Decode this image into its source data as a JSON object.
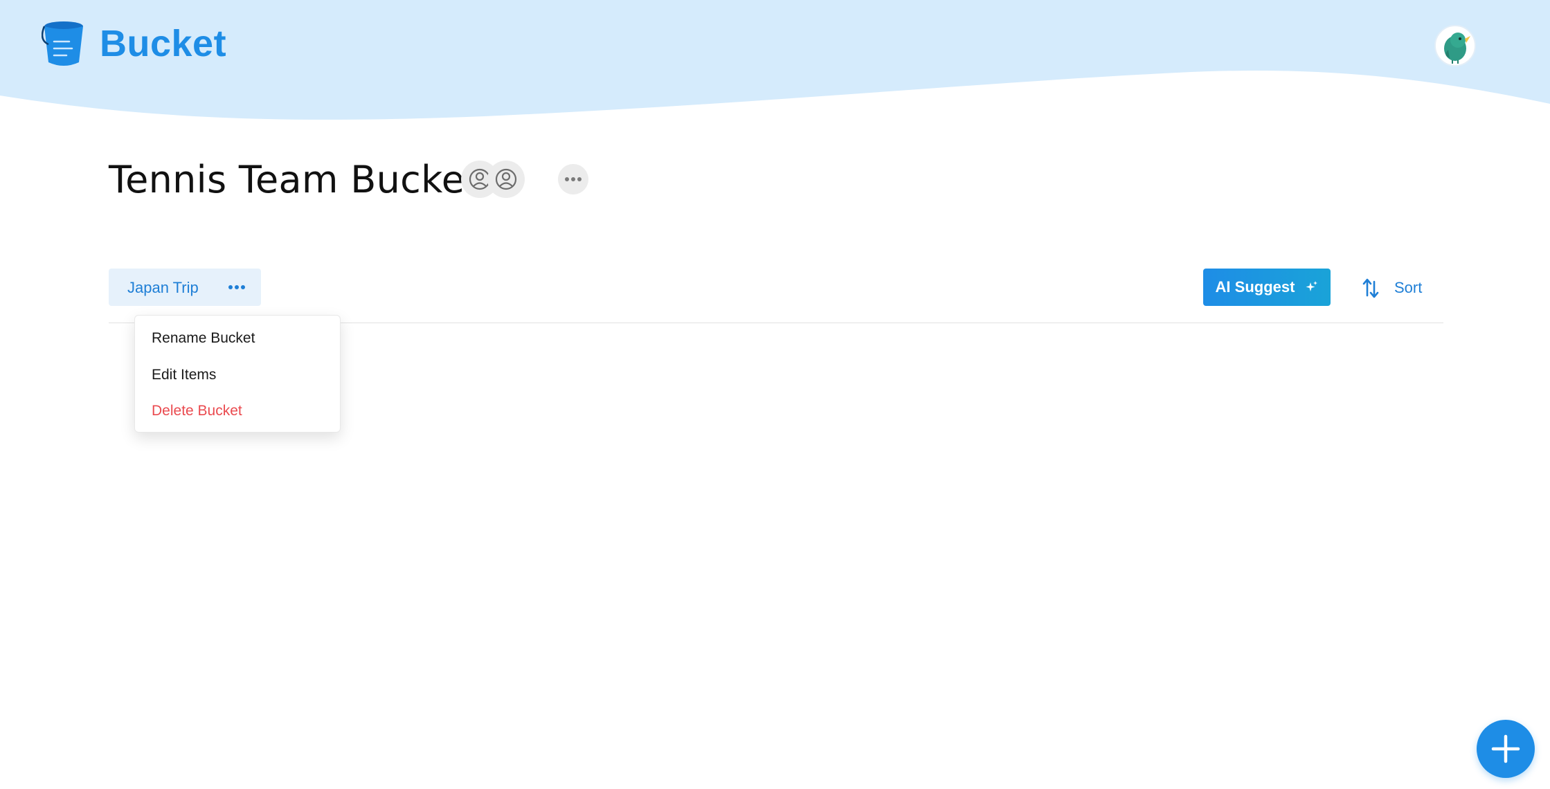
{
  "app": {
    "name": "Bucket",
    "brand_color": "#1e8de6",
    "header_color": "#d5ebfc"
  },
  "header": {
    "logo_icon": "bucket-icon",
    "user_avatar_icon": "bird-avatar-icon"
  },
  "page": {
    "title": "Tennis Team Buckets",
    "members": [
      {
        "icon": "user-circle-icon"
      },
      {
        "icon": "user-circle-icon"
      }
    ],
    "more_icon": "ellipsis-icon"
  },
  "bucket_tab": {
    "label": "Japan Trip",
    "more_icon": "ellipsis-icon"
  },
  "actions": {
    "ai_suggest_label": "AI Suggest",
    "ai_suggest_icon": "sparkle-icon",
    "sort_label": "Sort",
    "sort_icon": "sort-arrows-icon"
  },
  "dropdown": {
    "items": [
      {
        "label": "Rename Bucket"
      },
      {
        "label": "Edit Items"
      },
      {
        "label": "Delete Bucket",
        "color": "#ea4a4f"
      }
    ]
  },
  "fab": {
    "icon": "plus-icon"
  }
}
